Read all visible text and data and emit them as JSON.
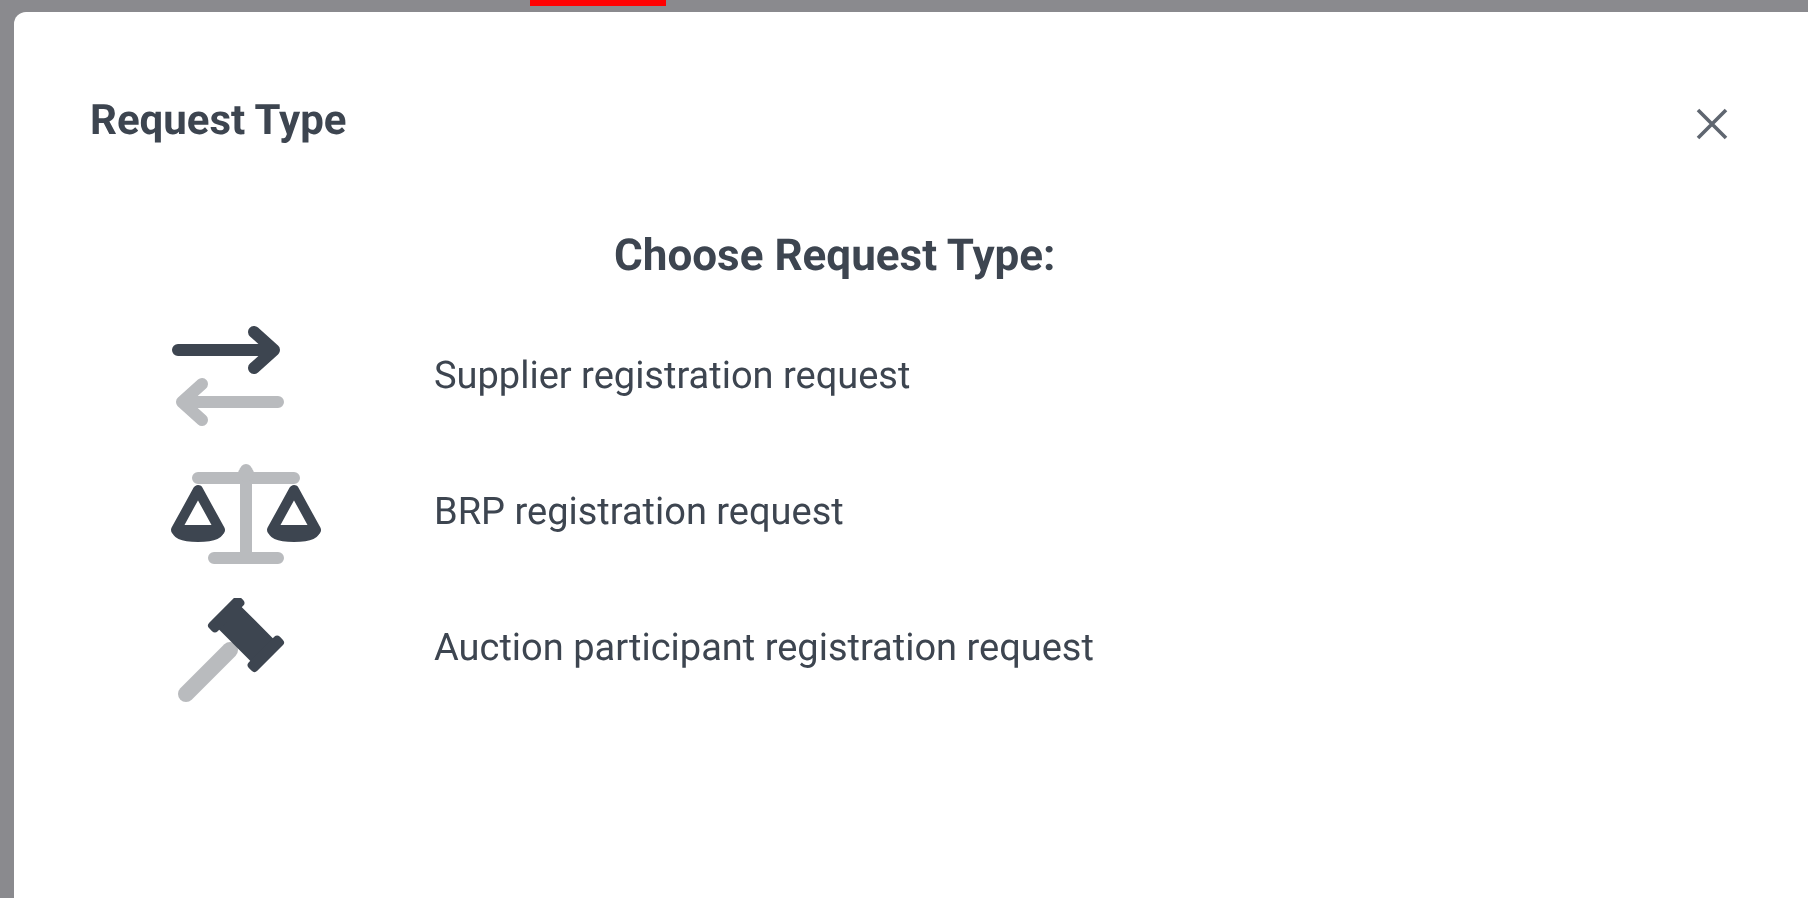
{
  "dialog": {
    "title": "Request Type",
    "heading": "Choose Request Type:"
  },
  "options": [
    {
      "kind": "exchange",
      "label": "Supplier registration request"
    },
    {
      "kind": "balance",
      "label": "BRP registration request"
    },
    {
      "kind": "gavel",
      "label": "Auction participant registration request"
    }
  ]
}
